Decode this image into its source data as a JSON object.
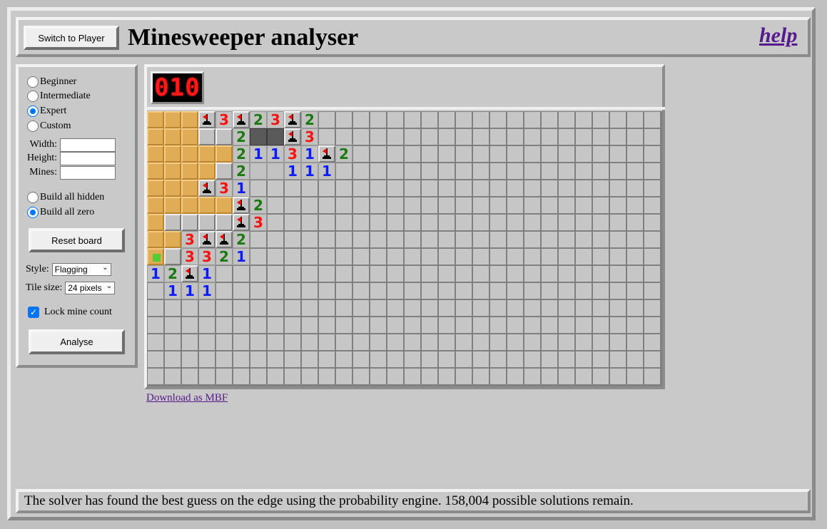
{
  "header": {
    "switch_button": "Switch to Player",
    "title": "Minesweeper analyser",
    "help_link": "help"
  },
  "sidebar": {
    "difficulty": [
      {
        "label": "Beginner",
        "checked": false
      },
      {
        "label": "Intermediate",
        "checked": false
      },
      {
        "label": "Expert",
        "checked": true
      },
      {
        "label": "Custom",
        "checked": false
      }
    ],
    "fields": [
      {
        "label": "Width:",
        "value": ""
      },
      {
        "label": "Height:",
        "value": ""
      },
      {
        "label": "Mines:",
        "value": ""
      }
    ],
    "build": [
      {
        "label": "Build all hidden",
        "checked": false
      },
      {
        "label": "Build all zero",
        "checked": true
      }
    ],
    "reset_button": "Reset board",
    "style_label": "Style:",
    "style_value": "Flagging",
    "tile_label": "Tile size:",
    "tile_value": "24 pixels",
    "lock_label": "Lock mine count",
    "lock_checked": true,
    "analyse_button": "Analyse"
  },
  "board": {
    "counter": "010",
    "columns": 30,
    "rows": 16,
    "legend": "h=hidden, z=zero(opened), o=open blank, g=gray raised, d=dark, f=flag, 1/2/3=number, s=safe guess",
    "grid": [
      "zzzf3f23f2hhhhhhhhhhhhhhhhhhhh",
      "zzzgg2ddf3hhhhhhhhhhhhhhhhhhhh",
      "zzzzz21131f2hhhhhhhhhhhhhhhhhh",
      "zzzzg2oo111hhhhhhhhhhhhhhhhhhh",
      "zzzf31hhhhhhhhhhhhhhhhhhhhhhhh",
      "zzzzzf2hhhhhhhhhhhhhhhhhhhhhhh",
      "zggggf3hhhhhhhhhhhhhhhhhhhhhhh",
      "zz3ff2hhhhhhhhhhhhhhhhhhhhhhhh",
      "sg3321hhhhhhhhhhhhhhhhhhhhhhhh",
      "12f1hhhhhhhhhhhhhhhhhhhhhhhhhh",
      "h111hhhhhhhhhhhhhhhhhhhhhhhhhh",
      "hhhhhhhhhhhhhhhhhhhhhhhhhhhhhh",
      "hhhhhhhhhhhhhhhhhhhhhhhhhhhhhh",
      "hhhhhhhhhhhhhhhhhhhhhhhhhhhhhh",
      "hhhhhhhhhhhhhhhhhhhhhhhhhhhhhh",
      "hhhhhhhhhhhhhhhhhhhhhhhhhhhhhh"
    ]
  },
  "download_link": "Download as MBF",
  "status_text": "The solver has found the best guess on the edge using the probability engine. 158,004 possible solutions remain."
}
